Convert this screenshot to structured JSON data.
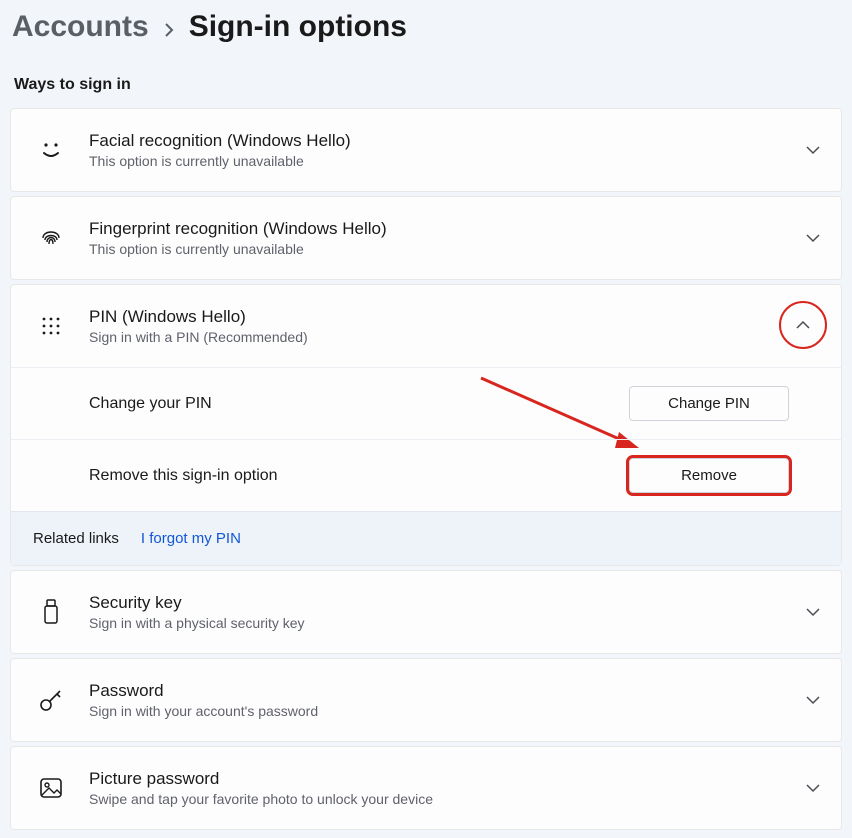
{
  "breadcrumb": {
    "parent": "Accounts",
    "current": "Sign-in options"
  },
  "section_header": "Ways to sign in",
  "options": {
    "face": {
      "title": "Facial recognition (Windows Hello)",
      "subtitle": "This option is currently unavailable"
    },
    "finger": {
      "title": "Fingerprint recognition (Windows Hello)",
      "subtitle": "This option is currently unavailable"
    },
    "pin": {
      "title": "PIN (Windows Hello)",
      "subtitle": "Sign in with a PIN (Recommended)",
      "change_label": "Change your PIN",
      "change_button": "Change PIN",
      "remove_label": "Remove this sign-in option",
      "remove_button": "Remove",
      "related_title": "Related links",
      "forgot_link": "I forgot my PIN"
    },
    "seckey": {
      "title": "Security key",
      "subtitle": "Sign in with a physical security key"
    },
    "password": {
      "title": "Password",
      "subtitle": "Sign in with your account's password"
    },
    "picpwd": {
      "title": "Picture password",
      "subtitle": "Swipe and tap your favorite photo to unlock your device"
    }
  }
}
